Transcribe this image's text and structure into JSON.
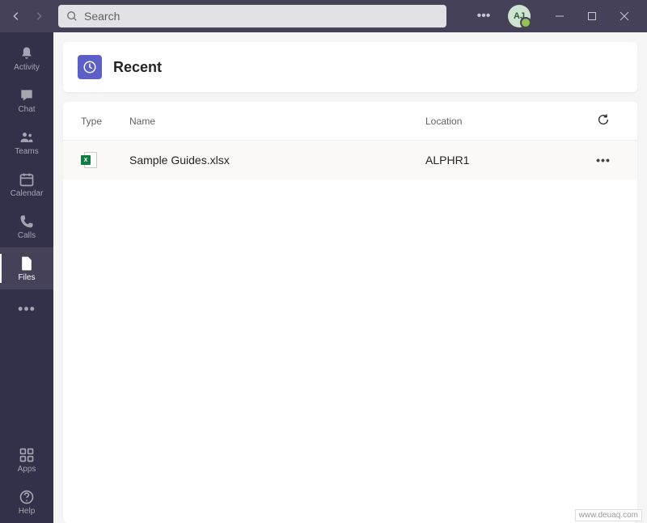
{
  "search": {
    "placeholder": "Search"
  },
  "avatar": {
    "initials": "AJ"
  },
  "sidebar": {
    "items": [
      {
        "label": "Activity"
      },
      {
        "label": "Chat"
      },
      {
        "label": "Teams"
      },
      {
        "label": "Calendar"
      },
      {
        "label": "Calls"
      },
      {
        "label": "Files"
      }
    ],
    "bottom": [
      {
        "label": "Apps"
      },
      {
        "label": "Help"
      }
    ]
  },
  "page": {
    "title": "Recent"
  },
  "columns": {
    "type": "Type",
    "name": "Name",
    "location": "Location"
  },
  "files": [
    {
      "name": "Sample Guides.xlsx",
      "location": "ALPHR1",
      "icon_letter": "X"
    }
  ],
  "watermark": "www.deuaq.com"
}
